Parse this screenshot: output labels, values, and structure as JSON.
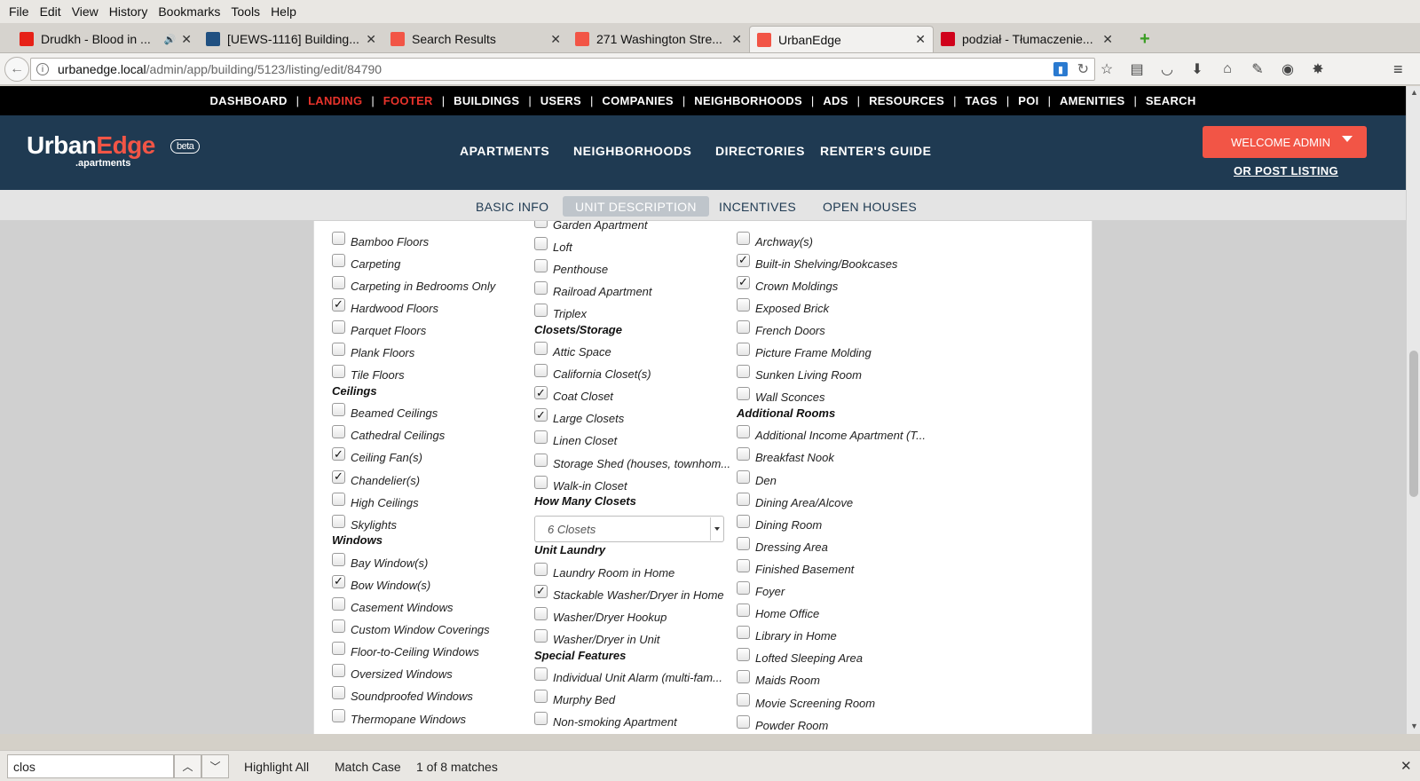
{
  "browser": {
    "menu": [
      "File",
      "Edit",
      "View",
      "History",
      "Bookmarks",
      "Tools",
      "Help"
    ],
    "tabs": [
      {
        "title": "Drudkh - Blood in ...",
        "favicon": "youtube-icon",
        "color": "#e62117",
        "has_audio": true
      },
      {
        "title": "[UEWS-1116] Building...",
        "favicon": "jira-icon",
        "color": "#205081"
      },
      {
        "title": "Search Results",
        "favicon": "ue-icon",
        "color": "#f25546"
      },
      {
        "title": "271 Washington Stre...",
        "favicon": "ue-icon",
        "color": "#f25546"
      },
      {
        "title": "UrbanEdge",
        "favicon": "ue-icon",
        "color": "#f25546",
        "active": true
      },
      {
        "title": "podział - Tłumaczenie...",
        "favicon": "dictionary-icon",
        "color": "#d0021b"
      }
    ],
    "url_host": "urbanedge.local",
    "url_path": "/admin/app/building/5123/listing/edit/84790"
  },
  "admin_bar": [
    "DASHBOARD",
    "LANDING",
    "FOOTER",
    "BUILDINGS",
    "USERS",
    "COMPANIES",
    "NEIGHBORHOODS",
    "ADS",
    "RESOURCES",
    "TAGS",
    "POI",
    "AMENITIES",
    "SEARCH"
  ],
  "admin_bar_highlight": [
    "LANDING",
    "FOOTER"
  ],
  "header": {
    "logo_urban": "Urban",
    "logo_edge": "Edge",
    "logo_sub": ".apartments",
    "logo_beta": "beta",
    "nav": [
      "APARTMENTS",
      "NEIGHBORHOODS",
      "DIRECTORIES",
      "RENTER'S GUIDE"
    ],
    "welcome": "WELCOME ADMIN",
    "post_listing": "OR POST LISTING"
  },
  "subnav": [
    "BASIC INFO",
    "UNIT DESCRIPTION",
    "INCENTIVES",
    "OPEN HOUSES"
  ],
  "subnav_active": "UNIT DESCRIPTION",
  "form": {
    "col1": [
      {
        "type": "item",
        "label": "Bamboo Floors",
        "checked": false
      },
      {
        "type": "item",
        "label": "Carpeting",
        "checked": false
      },
      {
        "type": "item",
        "label": "Carpeting in Bedrooms Only",
        "checked": false
      },
      {
        "type": "item",
        "label": "Hardwood Floors",
        "checked": true
      },
      {
        "type": "item",
        "label": "Parquet Floors",
        "checked": false
      },
      {
        "type": "item",
        "label": "Plank Floors",
        "checked": false
      },
      {
        "type": "item",
        "label": "Tile Floors",
        "checked": false
      },
      {
        "type": "heading",
        "label": "Ceilings"
      },
      {
        "type": "item",
        "label": "Beamed Ceilings",
        "checked": false
      },
      {
        "type": "item",
        "label": "Cathedral Ceilings",
        "checked": false
      },
      {
        "type": "item",
        "label": "Ceiling Fan(s)",
        "checked": true
      },
      {
        "type": "item",
        "label": "Chandelier(s)",
        "checked": true
      },
      {
        "type": "item",
        "label": "High Ceilings",
        "checked": false
      },
      {
        "type": "item",
        "label": "Skylights",
        "checked": false
      },
      {
        "type": "heading",
        "label": "Windows"
      },
      {
        "type": "item",
        "label": "Bay Window(s)",
        "checked": false
      },
      {
        "type": "item",
        "label": "Bow Window(s)",
        "checked": true
      },
      {
        "type": "item",
        "label": "Casement Windows",
        "checked": false
      },
      {
        "type": "item",
        "label": "Custom Window Coverings",
        "checked": false
      },
      {
        "type": "item",
        "label": "Floor-to-Ceiling Windows",
        "checked": false
      },
      {
        "type": "item",
        "label": "Oversized Windows",
        "checked": false
      },
      {
        "type": "item",
        "label": "Soundproofed Windows",
        "checked": false
      },
      {
        "type": "item",
        "label": "Thermopane Windows",
        "checked": false
      }
    ],
    "col2": [
      {
        "type": "item",
        "label": "Garden Apartment",
        "checked": false
      },
      {
        "type": "item",
        "label": "Loft",
        "checked": false
      },
      {
        "type": "item",
        "label": "Penthouse",
        "checked": false
      },
      {
        "type": "item",
        "label": "Railroad Apartment",
        "checked": false
      },
      {
        "type": "item",
        "label": "Triplex",
        "checked": false
      },
      {
        "type": "heading",
        "label": "Closets/Storage"
      },
      {
        "type": "item",
        "label": "Attic Space",
        "checked": false
      },
      {
        "type": "item",
        "label": "California Closet(s)",
        "checked": false
      },
      {
        "type": "item",
        "label": "Coat Closet",
        "checked": true
      },
      {
        "type": "item",
        "label": "Large Closets",
        "checked": true
      },
      {
        "type": "item",
        "label": "Linen Closet",
        "checked": false
      },
      {
        "type": "item",
        "label": "Storage Shed (houses, townhom...",
        "checked": false
      },
      {
        "type": "item",
        "label": "Walk-in Closet",
        "checked": false
      },
      {
        "type": "heading",
        "label": "How Many Closets"
      },
      {
        "type": "select",
        "value": "6 Closets"
      },
      {
        "type": "heading",
        "label": "Unit Laundry"
      },
      {
        "type": "item",
        "label": "Laundry Room in Home",
        "checked": false
      },
      {
        "type": "item",
        "label": "Stackable Washer/Dryer in Home",
        "checked": true
      },
      {
        "type": "item",
        "label": "Washer/Dryer Hookup",
        "checked": false
      },
      {
        "type": "item",
        "label": "Washer/Dryer in Unit",
        "checked": false
      },
      {
        "type": "heading",
        "label": "Special Features"
      },
      {
        "type": "item",
        "label": "Individual Unit Alarm (multi-fam...",
        "checked": false
      },
      {
        "type": "item",
        "label": "Murphy Bed",
        "checked": false
      },
      {
        "type": "item",
        "label": "Non-smoking Apartment",
        "checked": false
      }
    ],
    "col3": [
      {
        "type": "item",
        "label": "Archway(s)",
        "checked": false
      },
      {
        "type": "item",
        "label": "Built-in Shelving/Bookcases",
        "checked": true
      },
      {
        "type": "item",
        "label": "Crown Moldings",
        "checked": true
      },
      {
        "type": "item",
        "label": "Exposed Brick",
        "checked": false
      },
      {
        "type": "item",
        "label": "French Doors",
        "checked": false
      },
      {
        "type": "item",
        "label": "Picture Frame Molding",
        "checked": false
      },
      {
        "type": "item",
        "label": "Sunken Living Room",
        "checked": false
      },
      {
        "type": "item",
        "label": "Wall Sconces",
        "checked": false
      },
      {
        "type": "heading",
        "label": "Additional Rooms"
      },
      {
        "type": "item",
        "label": "Additional Income Apartment (T...",
        "checked": false
      },
      {
        "type": "item",
        "label": "Breakfast Nook",
        "checked": false
      },
      {
        "type": "item",
        "label": "Den",
        "checked": false
      },
      {
        "type": "item",
        "label": "Dining Area/Alcove",
        "checked": false
      },
      {
        "type": "item",
        "label": "Dining Room",
        "checked": false
      },
      {
        "type": "item",
        "label": "Dressing Area",
        "checked": false
      },
      {
        "type": "item",
        "label": "Finished Basement",
        "checked": false
      },
      {
        "type": "item",
        "label": "Foyer",
        "checked": false
      },
      {
        "type": "item",
        "label": "Home Office",
        "checked": false
      },
      {
        "type": "item",
        "label": "Library in Home",
        "checked": false
      },
      {
        "type": "item",
        "label": "Lofted Sleeping Area",
        "checked": false
      },
      {
        "type": "item",
        "label": "Maids Room",
        "checked": false
      },
      {
        "type": "item",
        "label": "Movie Screening Room",
        "checked": false
      },
      {
        "type": "item",
        "label": "Powder Room",
        "checked": false
      }
    ]
  },
  "findbar": {
    "query": "clos",
    "highlight_all": "Highlight All",
    "match_case": "Match Case",
    "status": "1 of 8 matches"
  }
}
